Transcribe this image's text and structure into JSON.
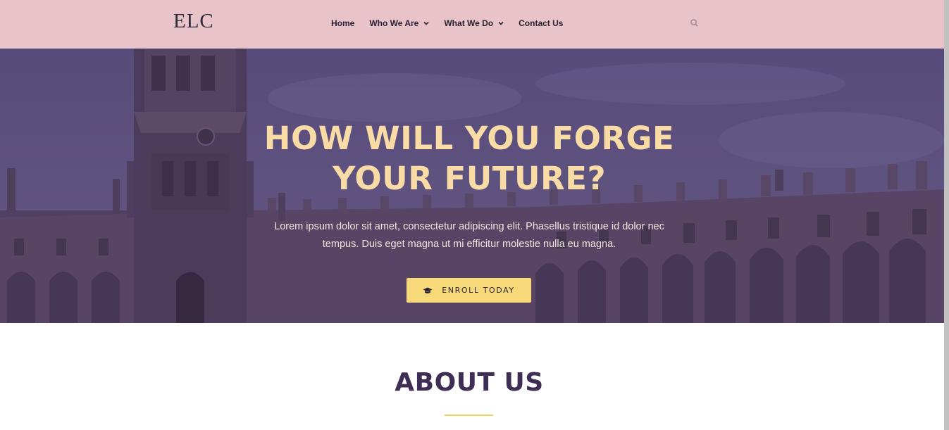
{
  "header": {
    "logo": "ELC",
    "nav": [
      {
        "label": "Home",
        "has_dropdown": false
      },
      {
        "label": "Who We Are",
        "has_dropdown": true
      },
      {
        "label": "What We Do",
        "has_dropdown": true
      },
      {
        "label": "Contact Us",
        "has_dropdown": false
      }
    ],
    "search_icon": "search-icon",
    "background_color": "#e8c3c9"
  },
  "hero": {
    "title_line1": "HOW WILL YOU FORGE",
    "title_line2": "YOUR FUTURE?",
    "text": "Lorem ipsum dolor sit amet, consectetur adipiscing elit. Phasellus tristique id dolor nec tempus. Duis eget magna ut mi efficitur molestie nulla eu magna.",
    "button_label": "ENROLL TODAY",
    "button_icon": "graduation-cap-icon",
    "title_color": "#f9dba6",
    "button_color": "#f8d97a",
    "overlay_color": "#5b4b78"
  },
  "about": {
    "title": "ABOUT US",
    "title_color": "#3e2d55",
    "accent_color": "#f3cf61"
  }
}
